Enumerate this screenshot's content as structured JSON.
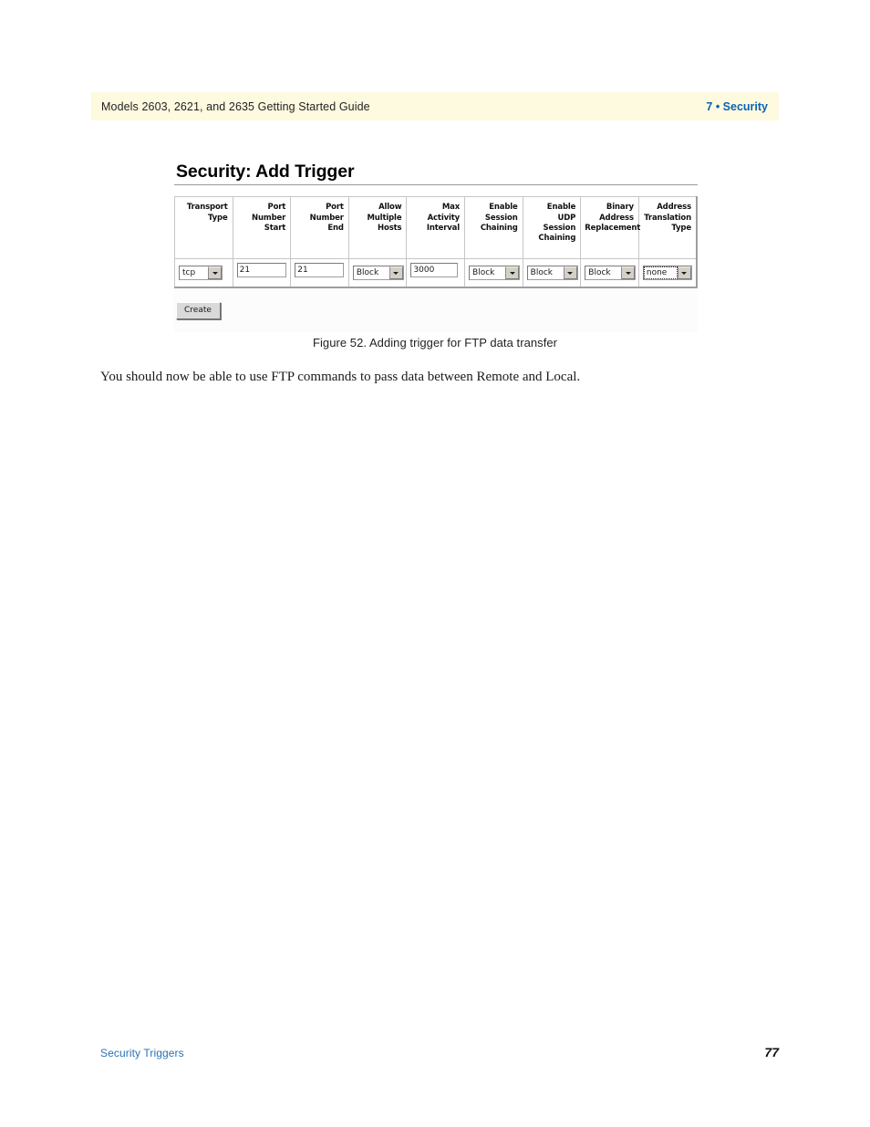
{
  "running_head": {
    "left_text": "Models 2603, 2621, and 2635 Getting Started Guide",
    "chapter_number": "7",
    "separator": "•",
    "chapter_title": "Security",
    "right_text": "7 • Security",
    "background_color": "#fdfae0",
    "accent_color": "#0c63b0"
  },
  "figure": {
    "screen": {
      "title": "Security: Add Trigger",
      "table": {
        "headers": [
          "Transport Type",
          "Port Number Start",
          "Port Number End",
          "Allow Multiple Hosts",
          "Max Activity Interval",
          "Enable Session Chaining",
          "Enable UDP Session Chaining",
          "Binary Address Replacement",
          "Address Translation Type"
        ],
        "header_lines": [
          [
            "Transport",
            "Type"
          ],
          [
            "Port",
            "Number",
            "Start"
          ],
          [
            "Port",
            "Number",
            "End"
          ],
          [
            "Allow",
            "Multiple",
            "Hosts"
          ],
          [
            "Max",
            "Activity",
            "Interval"
          ],
          [
            "Enable",
            "Session",
            "Chaining"
          ],
          [
            "Enable",
            "UDP",
            "Session",
            "Chaining"
          ],
          [
            "Binary",
            "Address",
            "Replacement"
          ],
          [
            "Address",
            "Translation",
            "Type"
          ]
        ],
        "row": [
          {
            "control": "select",
            "value": "tcp",
            "focused": false
          },
          {
            "control": "text",
            "value": "21",
            "focused": false
          },
          {
            "control": "text",
            "value": "21",
            "focused": false
          },
          {
            "control": "select",
            "value": "Block",
            "focused": false
          },
          {
            "control": "text",
            "value": "3000",
            "focused": false
          },
          {
            "control": "select",
            "value": "Block",
            "focused": false
          },
          {
            "control": "select",
            "value": "Block",
            "focused": false
          },
          {
            "control": "select",
            "value": "Block",
            "focused": false
          },
          {
            "control": "select",
            "value": "none",
            "focused": true
          }
        ]
      },
      "create_button_label": "Create"
    },
    "caption": "Figure 52. Adding trigger for FTP data transfer"
  },
  "body": {
    "paragraph": "You should now be able to use FTP commands to pass data between Remote and Local."
  },
  "footer": {
    "section_label": "Security Triggers",
    "page_number": "77",
    "link_color": "#2a72b5"
  }
}
